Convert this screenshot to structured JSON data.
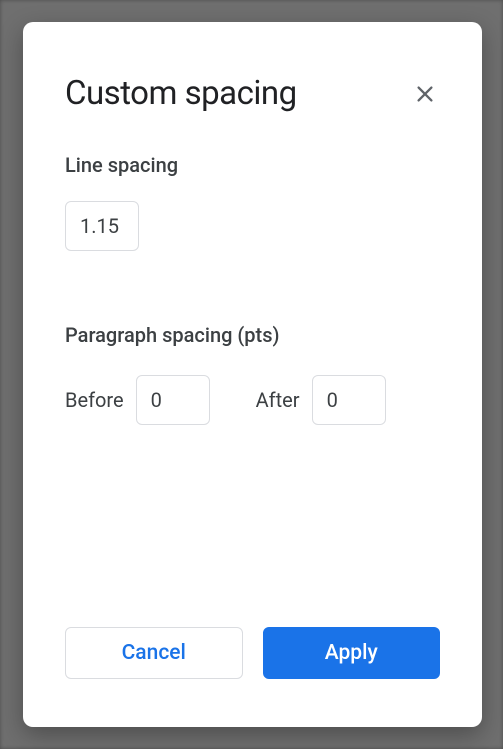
{
  "modal": {
    "title": "Custom spacing",
    "sections": {
      "line_spacing": {
        "label": "Line spacing",
        "value": "1.15"
      },
      "paragraph_spacing": {
        "label": "Paragraph spacing (pts)",
        "before_label": "Before",
        "before_value": "0",
        "after_label": "After",
        "after_value": "0"
      }
    },
    "buttons": {
      "cancel": "Cancel",
      "apply": "Apply"
    }
  }
}
